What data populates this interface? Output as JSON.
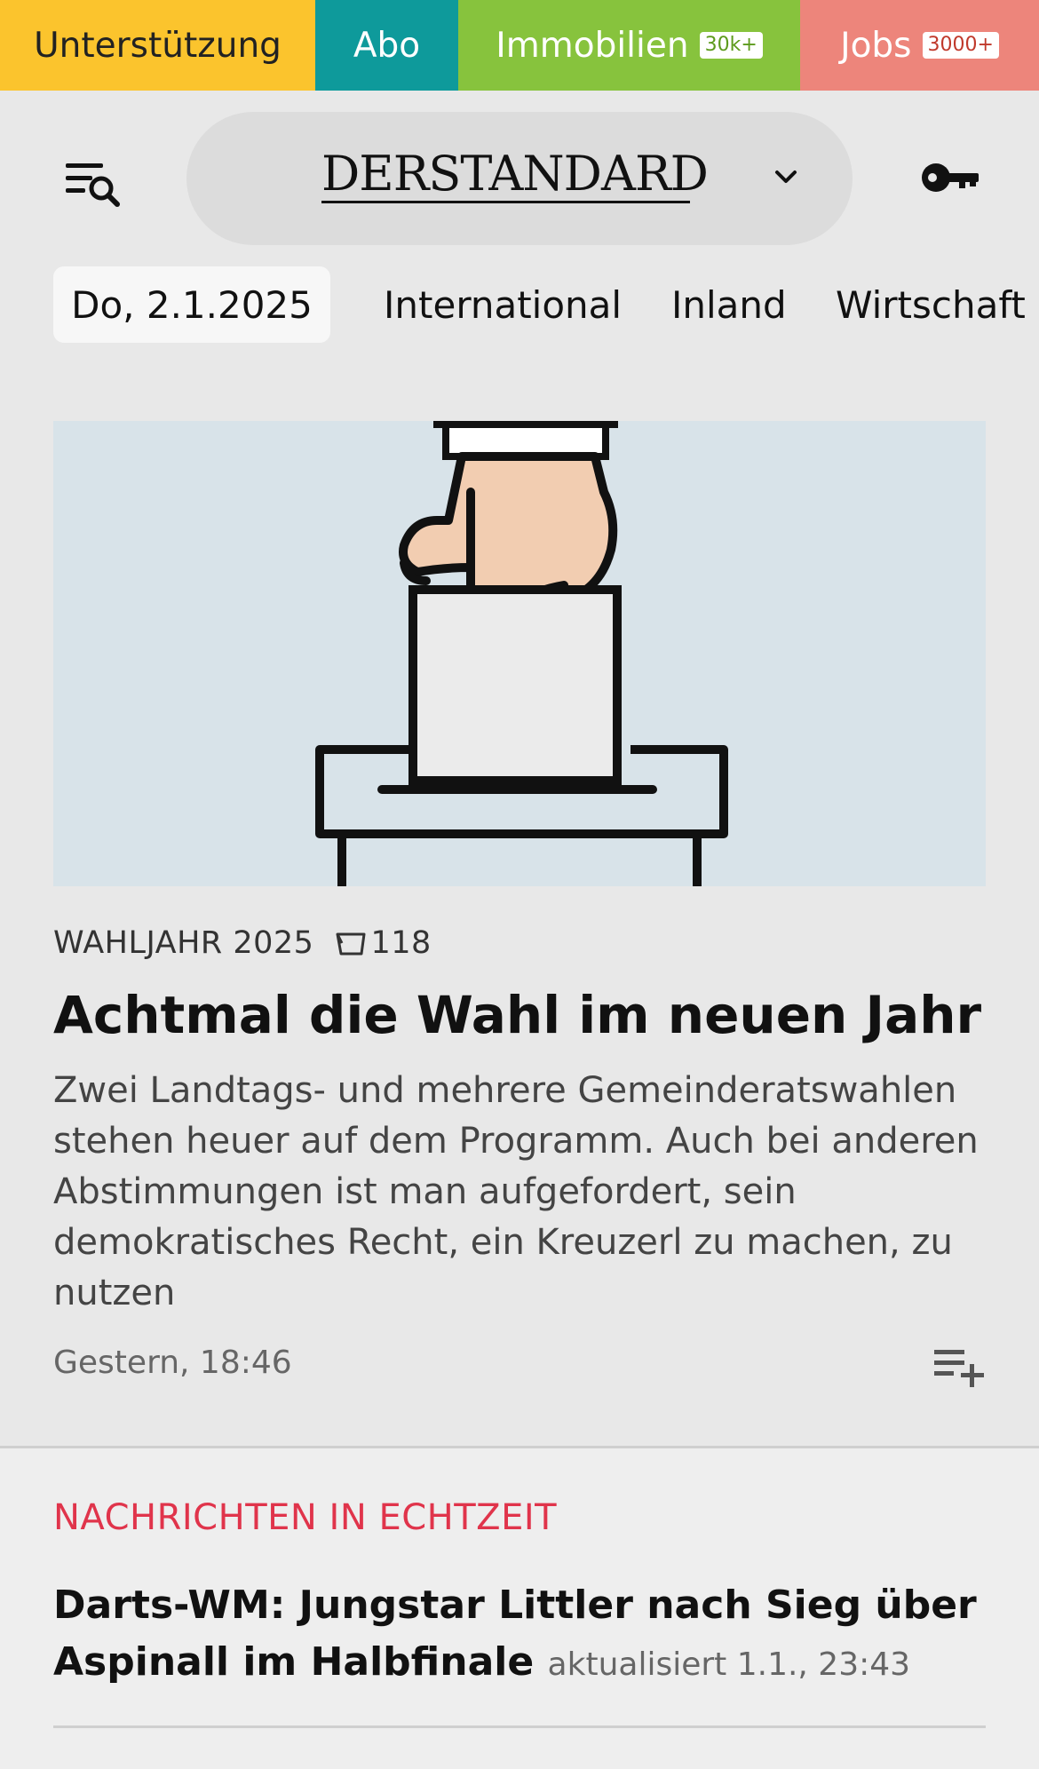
{
  "topbar": {
    "support_label": "Unterstützung",
    "abo_label": "Abo",
    "immo_label": "Immobilien",
    "immo_badge": "30k+",
    "jobs_label": "Jobs",
    "jobs_badge": "3000+",
    "colors": {
      "support": "#fbc42d",
      "abo": "#0e9a9b",
      "immo": "#87c33d",
      "jobs": "#ed857b"
    }
  },
  "header": {
    "brand": "DERSTANDARD",
    "menu_icon": "menu-search-icon",
    "chevron_icon": "chevron-down-icon",
    "key_icon": "key-icon"
  },
  "nav": {
    "date": "Do, 2.1.2025",
    "items": [
      "International",
      "Inland",
      "Wirtschaft"
    ]
  },
  "article": {
    "kicker": "WAHLJAHR 2025",
    "comments": "118",
    "headline": "Achtmal die Wahl im neuen Jahr",
    "teaser": "Zwei Landtags- und mehrere Gemeinderatswahlen stehen heuer auf dem Programm. Auch bei anderen Abstimmungen ist man aufgefordert, sein demokratisches Recht, ein Kreuzerl zu machen, zu nutzen",
    "timestamp": "Gestern, 18:46",
    "image_icon": "ballot-box-illustration"
  },
  "live": {
    "section_title": "NACHRICHTEN IN ECHTZEIT",
    "headline": "Darts-WM: Jungstar Littler nach Sieg über Aspi­nall im Halbfinale",
    "meta": "aktualisiert 1.1., 23:43",
    "accent_color": "#e0344b"
  }
}
